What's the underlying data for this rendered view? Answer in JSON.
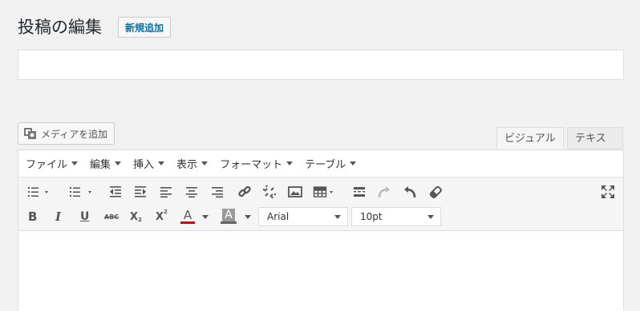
{
  "header": {
    "title": "投稿の編集",
    "add_new_label": "新規追加"
  },
  "title_field": {
    "value": "",
    "placeholder": ""
  },
  "media_button": {
    "label": "メディアを追加",
    "icon": "media-icon"
  },
  "tabs": {
    "visual": "ビジュアル",
    "text": "テキスト"
  },
  "menubar": [
    {
      "label": "ファイル"
    },
    {
      "label": "編集"
    },
    {
      "label": "挿入"
    },
    {
      "label": "表示"
    },
    {
      "label": "フォーマット"
    },
    {
      "label": "テーブル"
    }
  ],
  "toolbar": {
    "font_family": "Arial",
    "font_size": "10pt",
    "text_color": "#dd0000",
    "bg_color": "#666666",
    "text_color_letter": "A",
    "bg_color_letter": "A",
    "bold": "B",
    "italic": "I",
    "underline": "U",
    "strike": "ABC",
    "subscript": "X",
    "subscript_mark": "2",
    "superscript": "X",
    "superscript_mark": "2"
  }
}
